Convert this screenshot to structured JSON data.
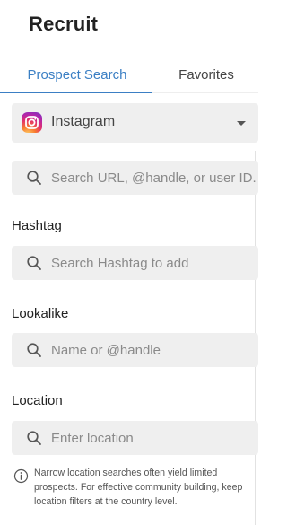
{
  "header": {
    "title": "Recruit"
  },
  "tabs": [
    {
      "label": "Prospect Search",
      "active": true
    },
    {
      "label": "Favorites",
      "active": false
    }
  ],
  "platform_select": {
    "selected": "Instagram",
    "icon": "instagram-icon"
  },
  "search": {
    "placeholder": "Search URL, @handle, or user ID."
  },
  "hashtag": {
    "label": "Hashtag",
    "placeholder": "Search Hashtag to add"
  },
  "lookalike": {
    "label": "Lookalike",
    "placeholder": "Name or @handle"
  },
  "location": {
    "label": "Location",
    "placeholder": "Enter location",
    "note": "Narrow location searches often yield limited prospects. For effective community building, keep location filters at the country level."
  },
  "colors": {
    "accent": "#3b7fc4",
    "field_bg": "#efefef",
    "text": "#222222"
  }
}
